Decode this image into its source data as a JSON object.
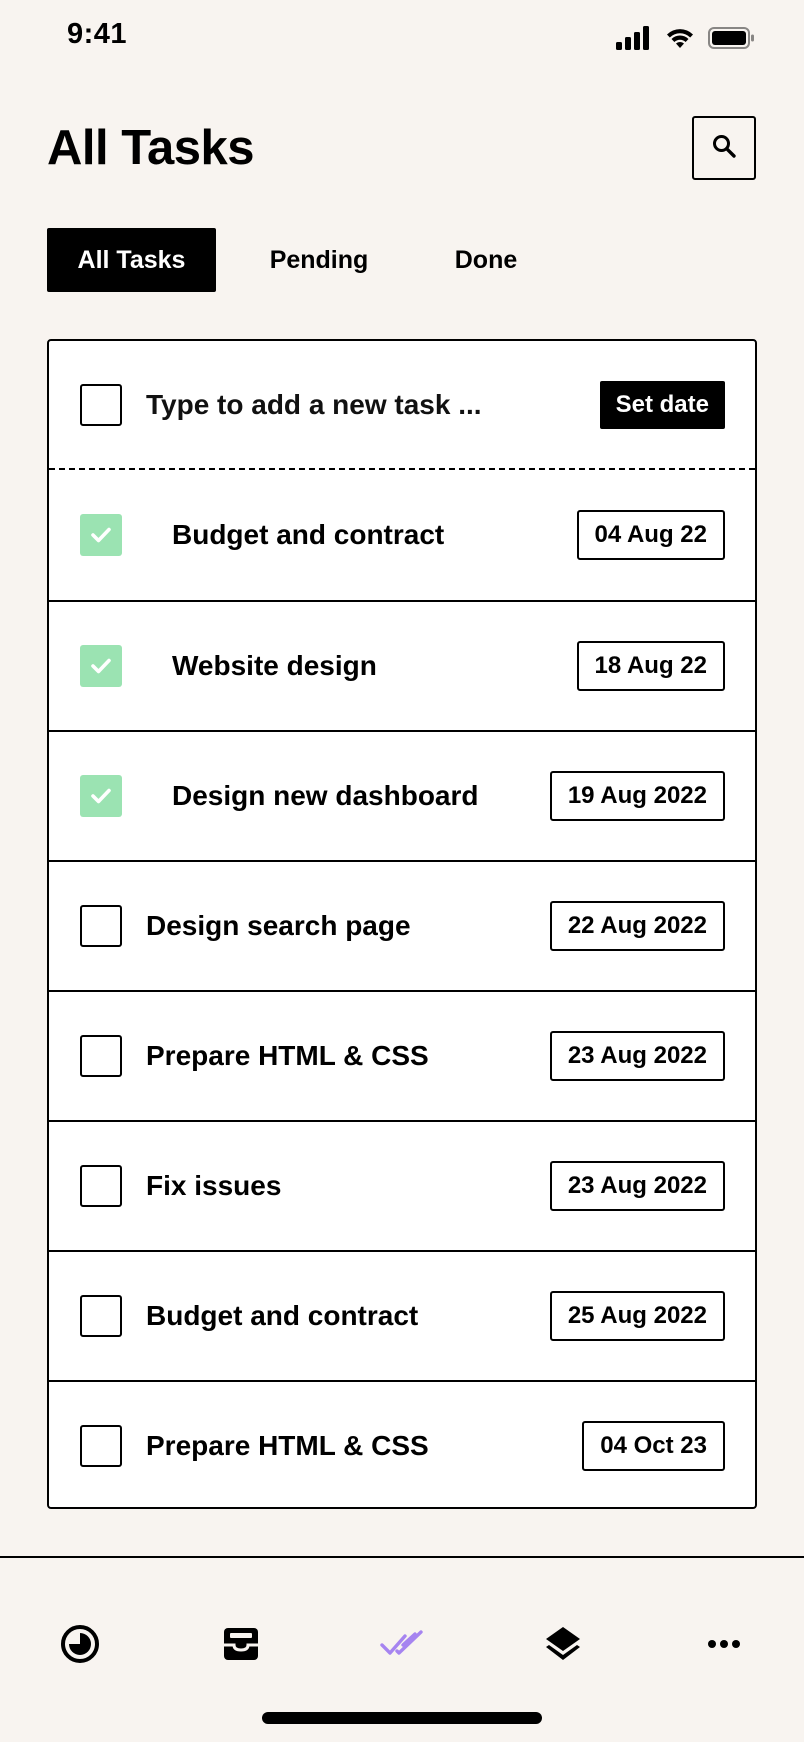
{
  "status_bar": {
    "time": "9:41"
  },
  "header": {
    "title": "All Tasks",
    "search_icon": "search-icon"
  },
  "tabs": [
    {
      "label": "All Tasks",
      "active": true
    },
    {
      "label": "Pending",
      "active": false
    },
    {
      "label": "Done",
      "active": false
    }
  ],
  "new_task": {
    "placeholder": "Type to add a new task ...",
    "set_date_label": "Set date"
  },
  "tasks": [
    {
      "label": "Budget and contract",
      "date": "04 Aug 22",
      "done": true
    },
    {
      "label": "Website design",
      "date": "18 Aug 22",
      "done": true
    },
    {
      "label": "Design new dashboard",
      "date": "19 Aug 2022",
      "done": true
    },
    {
      "label": "Design search page",
      "date": "22 Aug 2022",
      "done": false
    },
    {
      "label": "Prepare HTML & CSS",
      "date": "23 Aug 2022",
      "done": false
    },
    {
      "label": "Fix issues",
      "date": "23 Aug 2022",
      "done": false
    },
    {
      "label": "Budget and contract",
      "date": "25 Aug 2022",
      "done": false
    },
    {
      "label": "Prepare HTML & CSS",
      "date": "04 Oct 23",
      "done": false
    }
  ],
  "bottom_nav": [
    {
      "icon": "clock-icon",
      "active": false
    },
    {
      "icon": "inbox-icon",
      "active": false
    },
    {
      "icon": "double-check-icon",
      "active": true
    },
    {
      "icon": "layers-icon",
      "active": false
    },
    {
      "icon": "more-icon",
      "active": false
    }
  ],
  "colors": {
    "background": "#f8f4f0",
    "checked_green": "#9be3b2",
    "active_nav": "#a684f0"
  }
}
